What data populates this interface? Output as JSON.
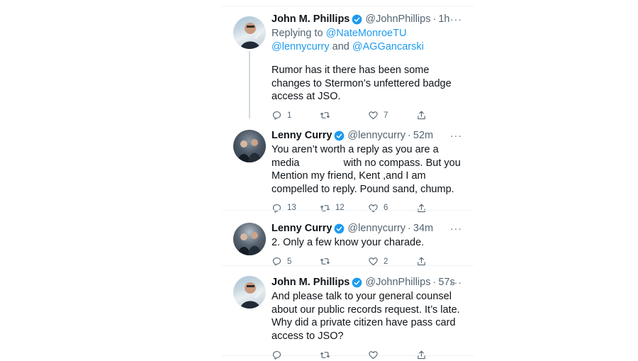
{
  "tweets": [
    {
      "name": "John M. Phillips",
      "handle": "@JohnPhillips",
      "time": "1h",
      "avatar": "john-phillips-avatar",
      "replying_prefix": "Replying to",
      "replying_mentions_1": "@NateMonroeTU @lennycurry",
      "replying_and": "and",
      "replying_mentions_2": "@AGGancarski",
      "text": "Rumor has it there has been some changes to Stermon’s unfettered badge access at JSO.",
      "replies": "1",
      "retweets": "",
      "likes": "7"
    },
    {
      "name": "Lenny Curry",
      "handle": "@lennycurry",
      "time": "52m",
      "avatar": "lenny-curry-avatar",
      "text_part1": "You aren’t worth a reply as you are a media",
      "text_part2": "with no compass. But you Mention my friend, Kent ,and I am compelled to reply. Pound sand, chump.",
      "replies": "13",
      "retweets": "12",
      "likes": "6"
    },
    {
      "name": "Lenny Curry",
      "handle": "@lennycurry",
      "time": "34m",
      "avatar": "lenny-curry-avatar",
      "text": "2. Only a few know your charade.",
      "replies": "5",
      "retweets": "",
      "likes": "2"
    },
    {
      "name": "John M. Phillips",
      "handle": "@JohnPhillips",
      "time": "57s",
      "avatar": "john-phillips-avatar",
      "text": "And please talk to your general counsel about our public records request. It’s late. Why did a private citizen have pass card access to JSO?",
      "replies": "",
      "retweets": "",
      "likes": ""
    }
  ],
  "ui": {
    "dot": "·",
    "more": "···"
  },
  "colors": {
    "verified": "#1d9bf0",
    "mention": "#1d9bf0",
    "secondary_text": "#536471",
    "thread_line": "#cfd9de"
  },
  "icons": [
    "verified-badge-icon",
    "reply-icon",
    "retweet-icon",
    "like-icon",
    "share-icon",
    "more-icon"
  ]
}
